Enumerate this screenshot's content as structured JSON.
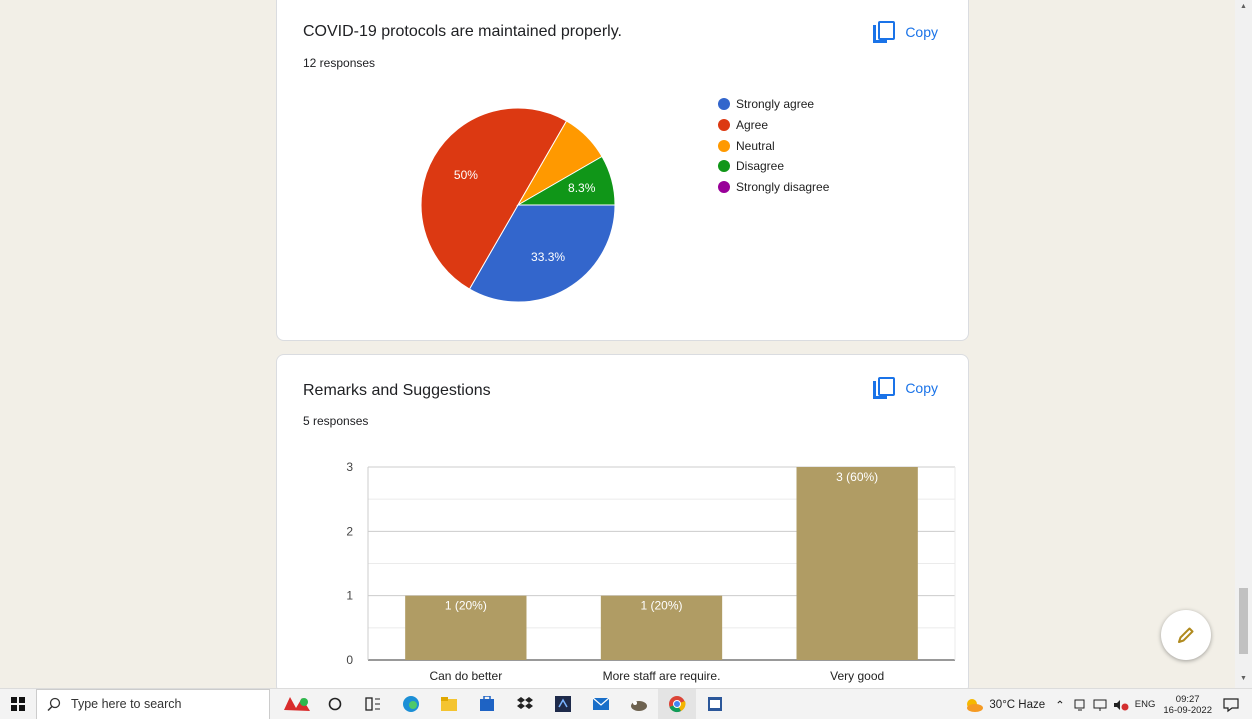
{
  "card1": {
    "title": "COVID-19 protocols are maintained properly.",
    "responses": "12 responses",
    "copy_label": "Copy"
  },
  "card2": {
    "title": "Remarks and Suggestions",
    "responses": "5 responses",
    "copy_label": "Copy"
  },
  "chart_data": [
    {
      "type": "pie",
      "title": "COVID-19 protocols are maintained properly.",
      "slices": [
        {
          "label": "Strongly agree",
          "value": 4,
          "percent_label": "33.3%",
          "color": "#3366cc"
        },
        {
          "label": "Agree",
          "value": 6,
          "percent_label": "50%",
          "color": "#dc3912"
        },
        {
          "label": "Neutral",
          "value": 1,
          "percent_label": "",
          "color": "#ff9900"
        },
        {
          "label": "Disagree",
          "value": 1,
          "percent_label": "8.3%",
          "color": "#109618"
        },
        {
          "label": "Strongly disagree",
          "value": 0,
          "percent_label": "",
          "color": "#990099"
        }
      ],
      "legend_position": "right"
    },
    {
      "type": "bar",
      "title": "Remarks and Suggestions",
      "categories": [
        "Can do better",
        "More staff are require.",
        "Very good"
      ],
      "values": [
        1,
        1,
        3
      ],
      "data_labels": [
        "1 (20%)",
        "1 (20%)",
        "3 (60%)"
      ],
      "ylim": [
        0,
        3
      ],
      "yticks": [
        "0",
        "1",
        "2",
        "3"
      ],
      "bar_color": "#b09c64",
      "grid": true
    }
  ],
  "taskbar": {
    "search_placeholder": "Type here to search",
    "weather": "30°C  Haze",
    "language": "ENG",
    "time": "09:27",
    "date": "16-09-2022"
  }
}
